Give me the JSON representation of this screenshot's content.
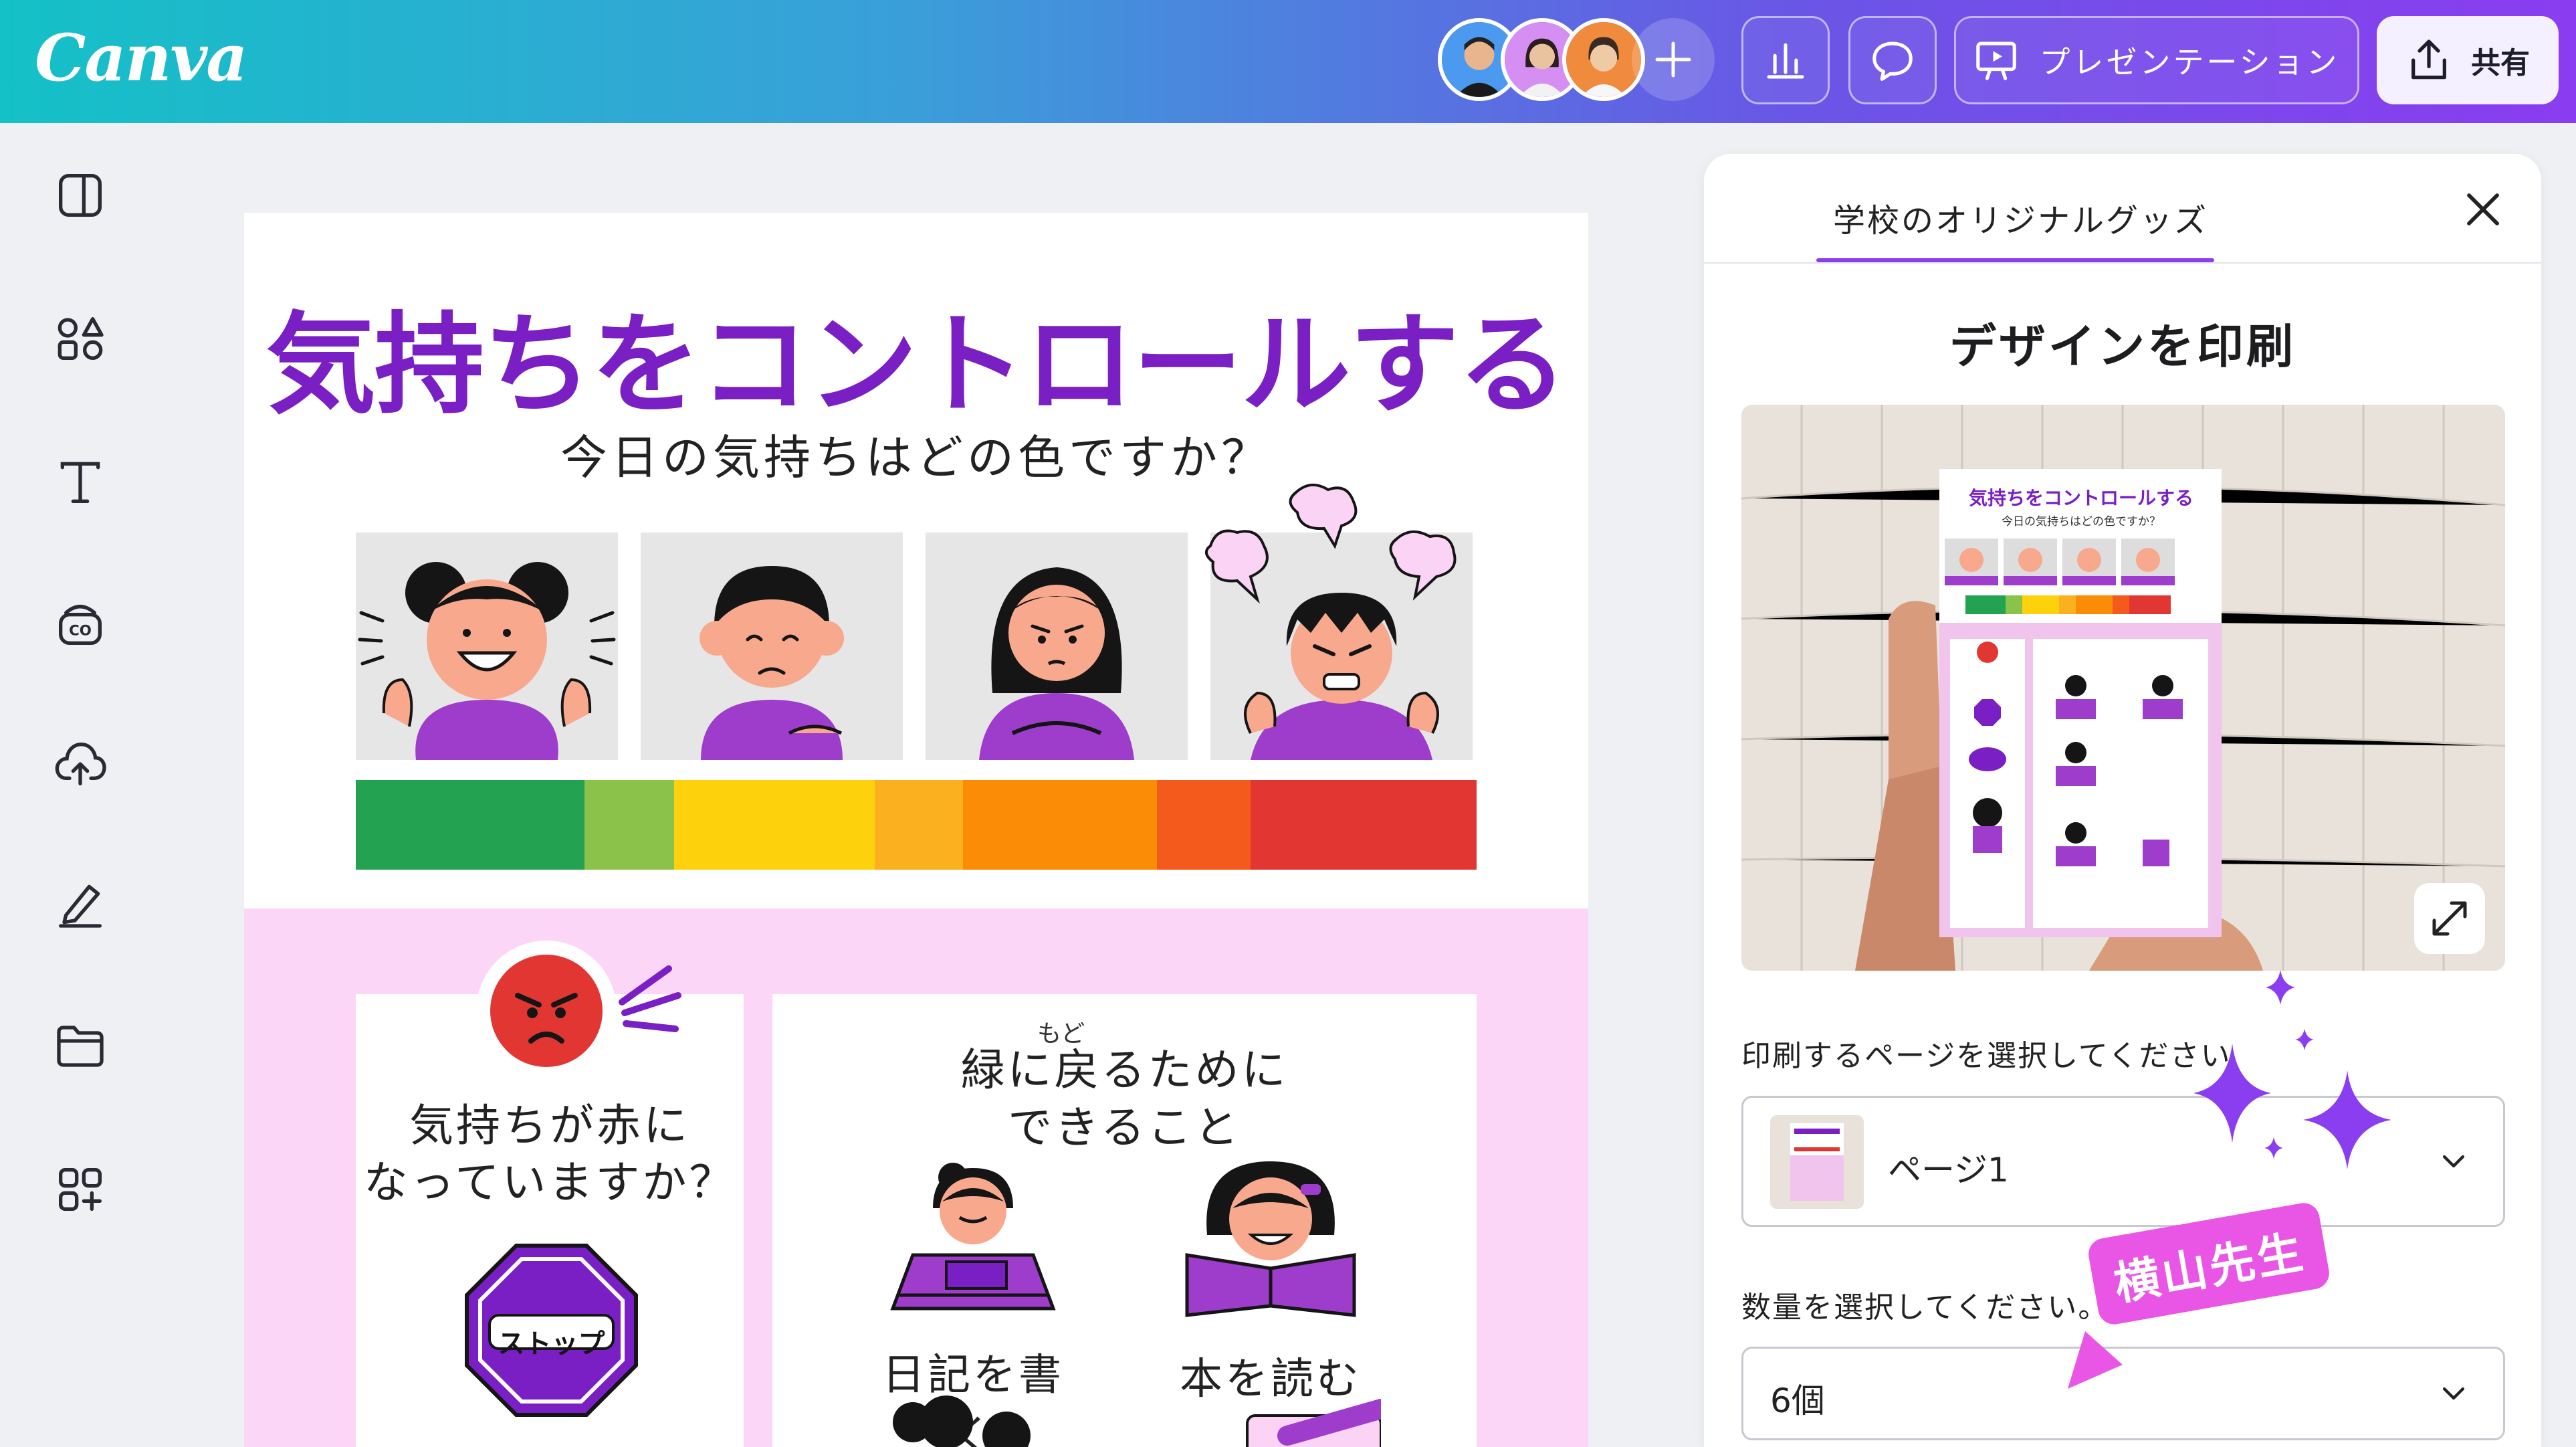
{
  "app": {
    "name": "Canva"
  },
  "topbar": {
    "logo": "Canva",
    "present_label": "プレゼンテーション",
    "share_label": "共有",
    "collaborators": [
      "avatar-man",
      "avatar-woman-1",
      "avatar-woman-2"
    ]
  },
  "sidebar": {
    "items": [
      "layout-icon",
      "elements-icon",
      "text-icon",
      "brand-icon",
      "upload-icon",
      "draw-icon",
      "folder-icon",
      "apps-icon"
    ]
  },
  "poster": {
    "title": "気持ちをコントロールする",
    "subtitle": "今日の気持ちはどの色ですか？",
    "color_scale": [
      "#23a352",
      "#8bc34a",
      "#fdd20c",
      "#fbb020",
      "#fb8c05",
      "#f35a1b",
      "#e23632"
    ],
    "left_card": {
      "text_line1": "気持ちが赤に",
      "text_line2": "なっていますか？",
      "stop_sign": "ストップ"
    },
    "right_card": {
      "ruby": "もど",
      "heading_line1": "緑に戻るために",
      "heading_line2": "できること",
      "activities": [
        "日記を書く",
        "本を読む"
      ]
    }
  },
  "panel": {
    "tab_label": "学校のオリジナルグッズ",
    "heading": "デザインを印刷",
    "page_select_label": "印刷するページを選択してください",
    "page_select_value": "ページ1",
    "quantity_label": "数量を選択してください。",
    "quantity_value": "6個",
    "mockup_title": "気持ちをコントロールする",
    "mockup_subtitle": "今日の気持ちはどの色ですか？"
  },
  "overlay": {
    "name_tag": "横山先生"
  },
  "colors": {
    "accent": "#8b3df0",
    "poster_purple": "#7a1fc4",
    "pink": "#fcd6f7",
    "tag_pink": "#e956e6"
  }
}
